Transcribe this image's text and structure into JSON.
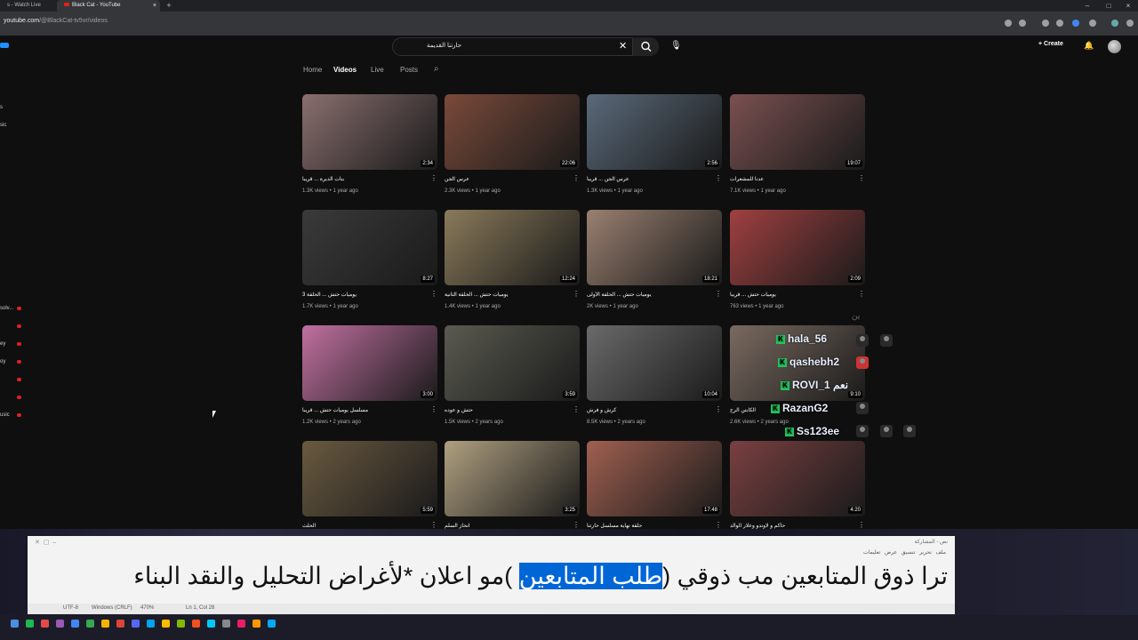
{
  "browser": {
    "tabs": [
      {
        "label": "s - Watch Live"
      },
      {
        "label": "Black Cat - YouTube"
      }
    ],
    "new_tab": "+",
    "url_host": "youtube.com",
    "url_path": "/@BlackCat-tv5vr/videos"
  },
  "header": {
    "search_value": "حارتنا القديمة",
    "create_label": "Create"
  },
  "sidebar": {
    "fragments": [
      "s",
      "sic",
      "solv...",
      "ey",
      "oy",
      "usic"
    ]
  },
  "channel_tabs": [
    {
      "label": "Home",
      "active": false
    },
    {
      "label": "Videos",
      "active": true
    },
    {
      "label": "Live",
      "active": false
    },
    {
      "label": "Posts",
      "active": false
    }
  ],
  "videos": [
    {
      "title": "بنات الديرة ... قريباً",
      "meta": "1.3K views • 1 year ago",
      "duration": "2:34",
      "color": "#8a6f6f"
    },
    {
      "title": "عرس الجن",
      "meta": "2.3K views • 1 year ago",
      "duration": "22:06",
      "color": "#7a4a3a"
    },
    {
      "title": "عرس الجن ... قريباً",
      "meta": "1.3K views • 1 year ago",
      "duration": "2:56",
      "color": "#5a6a7a"
    },
    {
      "title": "عدنا للمشعرات",
      "meta": "7.1K views • 1 year ago",
      "duration": "19:07",
      "color": "#7a5050"
    },
    {
      "title": "يوميات حتش ... الحلقة 3",
      "meta": "1.7K views • 1 year ago",
      "duration": "8:27",
      "color": "#3a3a3a"
    },
    {
      "title": "يوميات حتش ... الحلقة الثانية",
      "meta": "1.4K views • 1 year ago",
      "duration": "12:24",
      "color": "#8a7a5a"
    },
    {
      "title": "يوميات حتش ... الحلقة الأولى",
      "meta": "2K views • 1 year ago",
      "duration": "18:21",
      "color": "#9a8070"
    },
    {
      "title": "يوميات حتش ... قريباً",
      "meta": "763 views • 1 year ago",
      "duration": "2:09",
      "color": "#a04040"
    },
    {
      "title": "مسلسل يوميات حتش ... قريباً",
      "meta": "1.2K views • 2 years ago",
      "duration": "3:00",
      "color": "#c070a0"
    },
    {
      "title": "حتش و عوده",
      "meta": "1.5K views • 2 years ago",
      "duration": "3:59",
      "color": "#5a5a50"
    },
    {
      "title": "كرش و فرش",
      "meta": "8.5K views • 2 years ago",
      "duration": "10:04",
      "color": "#6a6a6a"
    },
    {
      "title": "الكابتن الرح",
      "meta": "2.6K views • 2 years ago",
      "duration": "9:10",
      "color": "#7a6a60"
    },
    {
      "title": "الحلث",
      "meta": "",
      "duration": "5:59",
      "color": "#6a5a40"
    },
    {
      "title": "انحاز السلم",
      "meta": "",
      "duration": "3:25",
      "color": "#b0a080"
    },
    {
      "title": "حلقة نهاية مسلسل حارتنا",
      "meta": "",
      "duration": "17:48",
      "color": "#a06050"
    },
    {
      "title": "حاكم و لاوندو وعلار الوالد",
      "meta": "",
      "duration": "4:20",
      "color": "#7a4040"
    }
  ],
  "chat": [
    {
      "user": "hala_56",
      "color": "#e8e8e8"
    },
    {
      "user": "qashebh2",
      "color": "#a8e8ff"
    },
    {
      "user": "ROVI_1",
      "color": "#e8e8ff"
    },
    {
      "user": "RazanG2",
      "color": "#e8e8e8"
    },
    {
      "user": "Ss123ee",
      "color": "#a8d8ff"
    }
  ],
  "chat_misc": [
    "نعم",
    "بن"
  ],
  "notepad": {
    "title": "نص - المشاركة",
    "menu": "ملف  تحرير  تنسيق  عرض  تعليمات",
    "text_before": "ترا ذوق المتابعين مب ذوقي (",
    "text_selected": "طلب المتابعين",
    "text_after": " )مو اعلان *لأغراض التحليل والنقد البناء",
    "status_encoding": "UTF-8",
    "status_eol": "Windows (CRLF)",
    "status_zoom": "470%",
    "status_pos": "Ln 1, Col 28"
  },
  "colors": {
    "yt_bg": "#0f0f0f",
    "selection": "#0066d6",
    "chat_badge": "#22c55e",
    "live_red": "#d22222"
  },
  "taskbar_icon_colors": [
    "#4a90e2",
    "#1db954",
    "#e24a4a",
    "#9b59b6",
    "#4285f4",
    "#34a853",
    "#f4b400",
    "#db4437",
    "#5865f2",
    "#00a4ef",
    "#ffb900",
    "#7fba00",
    "#f25022",
    "#00c8ff",
    "#888888",
    "#e91e63",
    "#ff9800",
    "#03a9f4"
  ]
}
